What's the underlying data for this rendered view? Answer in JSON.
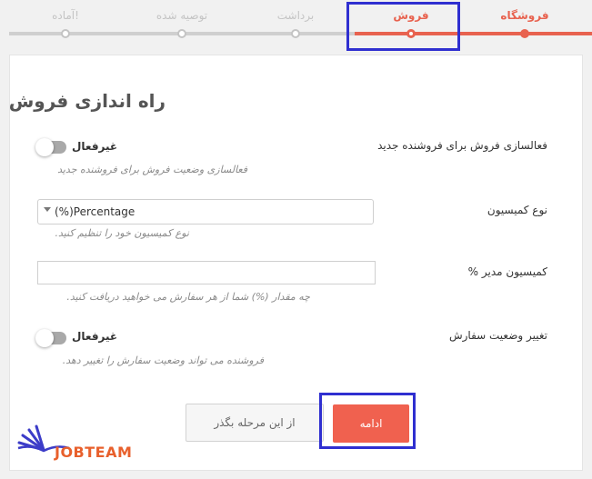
{
  "steps": [
    {
      "label": "فروشگاه",
      "state": "done"
    },
    {
      "label": "فروش",
      "state": "current"
    },
    {
      "label": "برداشت",
      "state": "todo"
    },
    {
      "label": "توصیه شده",
      "state": "todo"
    },
    {
      "label": "آماده!",
      "state": "todo"
    }
  ],
  "card": {
    "title": "راه اندازی فروش",
    "fields": {
      "enable_vendor": {
        "label": "فعالسازی فروش برای فروشنده جدید",
        "state_text": "غیرفعال",
        "help": "فعالسازی وضعیت فروش برای فروشنده جدید"
      },
      "commission_type": {
        "label": "نوع کمیسیون",
        "value": "(%)Percentage",
        "help": "نوع کمیسیون خود را تنظیم کنید."
      },
      "admin_commission": {
        "label": "کمیسیون مدیر %",
        "value": "",
        "help": "چه مقدار (%) شما از هر سفارش می خواهید دریافت کنید."
      },
      "order_status": {
        "label": "تغییر وضعیت سفارش",
        "state_text": "غیرفعال",
        "help": "فروشنده می تواند وضعیت سفارش را تغییر دهد."
      }
    },
    "buttons": {
      "skip": "از این مرحله بگذر",
      "continue": "ادامه"
    }
  },
  "logo": {
    "text": "JOBTEAM"
  },
  "colors": {
    "accent": "#e8624f",
    "highlight": "#2f2fd0",
    "inactive": "#c4c4c4"
  }
}
